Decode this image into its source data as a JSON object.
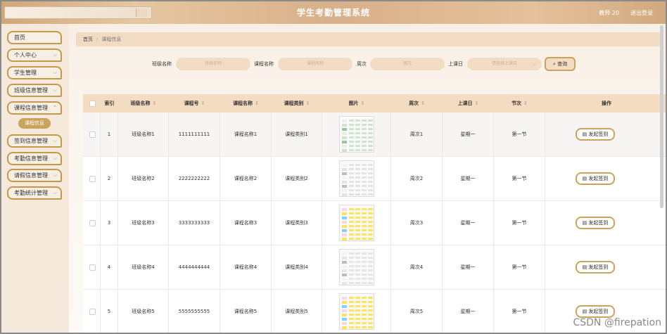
{
  "header": {
    "title": "学生考勤管理系统",
    "user": "教师 20",
    "logout": "退出登录"
  },
  "sidebar": {
    "items": [
      {
        "label": "首页",
        "has_chevron": false
      },
      {
        "label": "个人中心",
        "has_chevron": true
      },
      {
        "label": "学生管理",
        "has_chevron": true
      },
      {
        "label": "班级信息管理",
        "has_chevron": true
      },
      {
        "label": "课程信息管理",
        "has_chevron": true
      },
      {
        "label": "签到信息管理",
        "has_chevron": true
      },
      {
        "label": "考勤信息管理",
        "has_chevron": true
      },
      {
        "label": "请假信息管理",
        "has_chevron": true
      },
      {
        "label": "考勤统计管理",
        "has_chevron": true
      }
    ],
    "active_sub": "课程信息"
  },
  "breadcrumb": {
    "home": "首页",
    "current": "课程信息"
  },
  "search": {
    "class_label": "班级名称",
    "class_placeholder": "班级名称",
    "course_label": "课程名称",
    "course_placeholder": "课程名称",
    "week_label": "周次",
    "week_placeholder": "周次",
    "day_label": "上课日",
    "day_placeholder": "请选择上课日",
    "button": "查询"
  },
  "table": {
    "headers": {
      "index": "索引",
      "class_name": "班级名称",
      "course_no": "课程号",
      "course_name": "课程名称",
      "course_type": "课程类别",
      "image": "图片",
      "week": "周次",
      "day": "上课日",
      "section": "节次",
      "action": "操作"
    },
    "rows": [
      {
        "index": "1",
        "class_name": "班级名称1",
        "course_no": "1111111111",
        "course_name": "课程名称1",
        "course_type": "课程类别1",
        "week": "周次1",
        "day": "星期一",
        "section": "第一节",
        "action": "发起签到"
      },
      {
        "index": "2",
        "class_name": "班级名称2",
        "course_no": "2222222222",
        "course_name": "课程名称2",
        "course_type": "课程类别2",
        "week": "周次2",
        "day": "星期一",
        "section": "第一节",
        "action": "发起签到"
      },
      {
        "index": "3",
        "class_name": "班级名称3",
        "course_no": "3333333333",
        "course_name": "课程名称3",
        "course_type": "课程类别3",
        "week": "周次3",
        "day": "星期一",
        "section": "第一节",
        "action": "发起签到"
      },
      {
        "index": "4",
        "class_name": "班级名称4",
        "course_no": "4444444444",
        "course_name": "课程名称4",
        "course_type": "课程类别4",
        "week": "周次4",
        "day": "星期一",
        "section": "第一节",
        "action": "发起签到"
      },
      {
        "index": "5",
        "class_name": "班级名称5",
        "course_no": "5555555555",
        "course_name": "课程名称5",
        "course_type": "课程类别5",
        "week": "周次5",
        "day": "星期一",
        "section": "第一节",
        "action": "发起签到"
      }
    ]
  },
  "watermark": "CSDN @firepation",
  "colors": {
    "accent": "#c9a45a",
    "header_bg": "#d8b089",
    "table_header_bg": "#f4dcc0"
  }
}
